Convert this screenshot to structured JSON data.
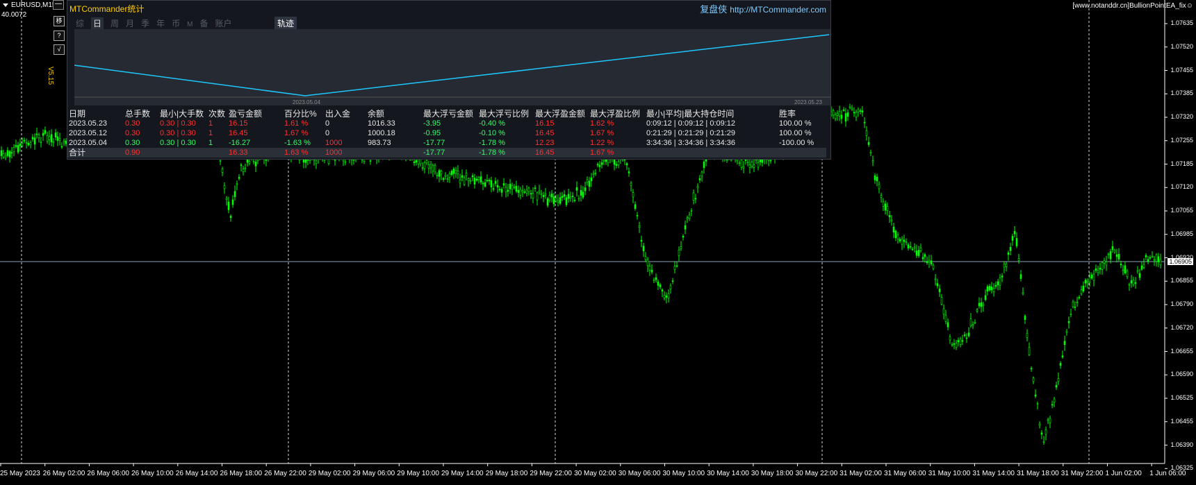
{
  "chart": {
    "symbol": "EURUSD,M15",
    "sub_value": "40.0072",
    "version": "V5.15",
    "top_right_text": "[www.notanddr.cn]BullionPointEA_fix☺",
    "current_price": "1.06905",
    "price_labels": [
      "1.07635",
      "1.07520",
      "1.07455",
      "1.07385",
      "1.07320",
      "1.07255",
      "1.07185",
      "1.07120",
      "1.07055",
      "1.06985",
      "1.06920",
      "1.06855",
      "1.06790",
      "1.06720",
      "1.06655",
      "1.06590",
      "1.06525",
      "1.06455",
      "1.06390",
      "1.06325"
    ],
    "time_labels": [
      "25 May 2023",
      "26 May 02:00",
      "26 May 06:00",
      "26 May 10:00",
      "26 May 14:00",
      "26 May 18:00",
      "26 May 22:00",
      "29 May 02:00",
      "29 May 06:00",
      "29 May 10:00",
      "29 May 14:00",
      "29 May 18:00",
      "29 May 22:00",
      "30 May 02:00",
      "30 May 06:00",
      "30 May 10:00",
      "30 May 14:00",
      "30 May 18:00",
      "30 May 22:00",
      "31 May 02:00",
      "31 May 06:00",
      "31 May 10:00",
      "31 May 14:00",
      "31 May 18:00",
      "31 May 22:00",
      "1 Jun 02:00",
      "1 Jun 06:00"
    ],
    "colors": {
      "bull": "#00ff00",
      "bear": "#00ff00",
      "background": "#000000"
    }
  },
  "side_buttons": [
    "移",
    "?",
    "√"
  ],
  "minimize_label": "—",
  "panel": {
    "title": "MTCommander统计",
    "link_cn": "复盘侠",
    "link_url": "http://MTCommander.com",
    "tabs": [
      "综",
      "日",
      "周",
      "月",
      "季",
      "年",
      "币",
      "M",
      "备",
      "账户"
    ],
    "selected_tab": "日",
    "trace_button": "轨迹",
    "mini_chart": {
      "start_date": "2023.05.04",
      "end_date": "2023.05.23",
      "line_color": "#1ec8ff"
    },
    "headers": [
      "日期",
      "总手数",
      "最小|大手数",
      "次数",
      "盈亏金额",
      "百分比%",
      "出入金",
      "余额",
      "最大浮亏金额",
      "最大浮亏比例",
      "最大浮盈金额",
      "最大浮盈比例",
      "最小|平均|最大持仓时间",
      "胜率"
    ],
    "rows": [
      {
        "date": "2023.05.23",
        "lots": "0.30",
        "minmax": "0.30 | 0.30",
        "count": "1",
        "pnl": "16.15",
        "pct": "1.61 %",
        "inout": "0",
        "balance": "1016.33",
        "maxloss": "-3.95",
        "maxlosspct": "-0.40 %",
        "maxprofit": "16.15",
        "maxprofitpct": "1.62 %",
        "hold": "0:09:12 | 0:09:12 | 0:09:12",
        "win": "100.00 %"
      },
      {
        "date": "2023.05.12",
        "lots": "0.30",
        "minmax": "0.30 | 0.30",
        "count": "1",
        "pnl": "16.45",
        "pct": "1.67 %",
        "inout": "0",
        "balance": "1000.18",
        "maxloss": "-0.95",
        "maxlosspct": "-0.10 %",
        "maxprofit": "16.45",
        "maxprofitpct": "1.67 %",
        "hold": "0:21:29 | 0:21:29 | 0:21:29",
        "win": "100.00 %"
      },
      {
        "date": "2023.05.04",
        "lots": "0.30",
        "minmax": "0.30 | 0.30",
        "count": "1",
        "pnl": "-16.27",
        "pct": "-1.63 %",
        "inout": "1000",
        "balance": "983.73",
        "maxloss": "-17.77",
        "maxlosspct": "-1.78 %",
        "maxprofit": "12.23",
        "maxprofitpct": "1.22 %",
        "hold": "3:34:36 | 3:34:36 | 3:34:36",
        "win": "-100.00 %"
      }
    ],
    "total": {
      "label": "合计",
      "lots": "0.90",
      "pnl": "16.33",
      "pct": "1.63 %",
      "inout": "1000",
      "maxloss": "-17.77",
      "maxlosspct": "-1.78 %",
      "maxprofit": "16.45",
      "maxprofitpct": "1.67 %"
    }
  }
}
